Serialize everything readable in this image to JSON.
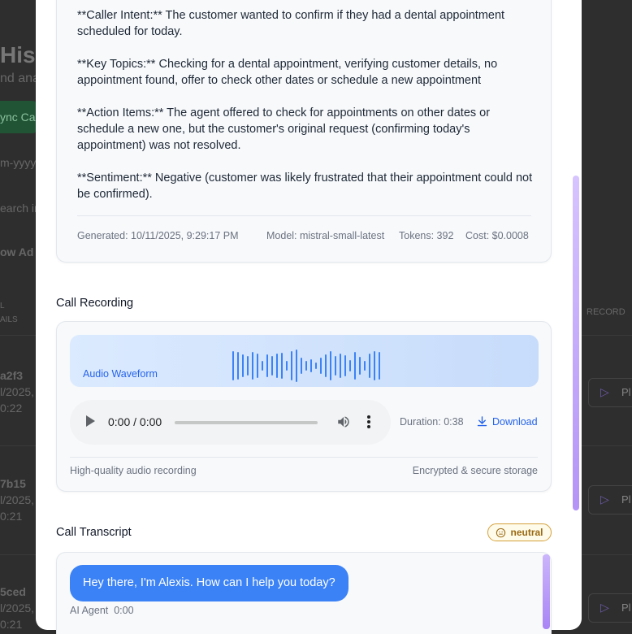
{
  "background": {
    "title": "Hist",
    "subtitle": "nd ana",
    "sync_button": "ync Ca",
    "date_placeholder": "m-yyyy",
    "search_placeholder": "earch in",
    "filters_toggle": "ow Ad",
    "col_details": "L\nAILS",
    "col_recording": "RECORD",
    "rows": [
      {
        "id": "a2f3",
        "date": "l/2025,",
        "time": "0:22",
        "play": "Pl"
      },
      {
        "id": "7b15",
        "date": "l/2025,",
        "time": "0:21",
        "play": "Pl"
      },
      {
        "id": "5ced",
        "date": "l/2025,",
        "time": "0:21",
        "play": "Pl"
      }
    ]
  },
  "summary": {
    "caller_intent": "**Caller Intent:** The customer wanted to confirm if they had a dental appointment scheduled for today.",
    "key_topics": "**Key Topics:** Checking for a dental appointment, verifying customer details, no appointment found, offer to check other dates or schedule a new appointment",
    "action_items": "**Action Items:** The agent offered to check for appointments on other dates or schedule a new one, but the customer's original request (confirming today's appointment) was not resolved.",
    "sentiment": "**Sentiment:** Negative (customer was likely frustrated that their appointment could not be confirmed).",
    "generated": "Generated: 10/11/2025, 9:29:17 PM",
    "model": "Model: mistral-small-latest",
    "tokens": "Tokens: 392",
    "cost": "Cost: $0.0008"
  },
  "recording": {
    "section_title": "Call Recording",
    "waveform_label": "Audio Waveform",
    "player_time": "0:00 / 0:00",
    "duration": "Duration: 0:38",
    "download": "Download",
    "quality_note": "High-quality audio recording",
    "storage_note": "Encrypted & secure storage"
  },
  "transcript": {
    "section_title": "Call Transcript",
    "sentiment_badge": "neutral",
    "messages": [
      {
        "text": "Hey there, I'm Alexis. How can I help you today?",
        "speaker": "AI Agent",
        "time": "0:00"
      }
    ]
  },
  "colors": {
    "accent_blue": "#3b82f6",
    "scrollbar_purple": "#b593f7",
    "badge_amber": "#d4a03a"
  }
}
